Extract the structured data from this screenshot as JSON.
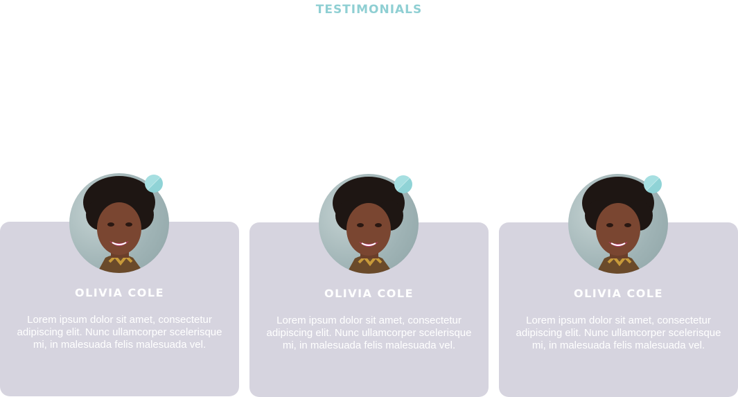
{
  "section": {
    "title": "TESTIMONIALS"
  },
  "testimonials": [
    {
      "name": "OLIVIA COLE",
      "quote": "Lorem ipsum dolor sit amet, consectetur adipiscing elit. Nunc ullamcorper scelerisque mi, in malesuada felis malesuada vel."
    },
    {
      "name": "OLIVIA COLE",
      "quote": "Lorem ipsum dolor sit amet, consectetur adipiscing elit. Nunc ullamcorper scelerisque mi, in malesuada felis malesuada vel."
    },
    {
      "name": "OLIVIA COLE",
      "quote": "Lorem ipsum dolor sit amet, consectetur adipiscing elit. Nunc ullamcorper scelerisque mi, in malesuada felis malesuada vel."
    }
  ],
  "colors": {
    "accent": "#8fcfd3",
    "card_background": "#d6d4df",
    "text_on_card": "#ffffff"
  },
  "icons": {
    "avatar_badge": "badge-dot-icon"
  }
}
